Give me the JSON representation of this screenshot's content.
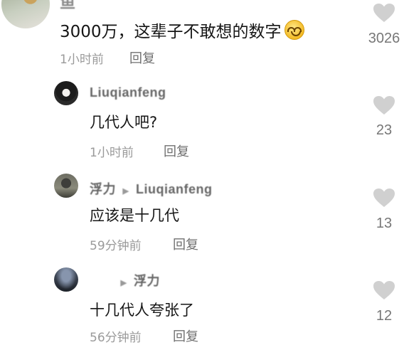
{
  "comments": [
    {
      "username": "鱼",
      "text": "3000万，这辈子不敢想的数字",
      "emoji": "smiling-emoji",
      "time": "1小时前",
      "reply_label": "回复",
      "likes": "3026"
    },
    {
      "username": "Liuqianfeng",
      "text": "几代人吧?",
      "time": "1小时前",
      "reply_label": "回复",
      "likes": "23"
    },
    {
      "username": "浮力",
      "reply_to": "Liuqianfeng",
      "text": "应该是十几代",
      "time": "59分钟前",
      "reply_label": "回复",
      "likes": "13"
    },
    {
      "username": "",
      "reply_to": "浮力",
      "text": "十几代人夸张了",
      "time": "56分钟前",
      "reply_label": "回复",
      "likes": "12"
    }
  ],
  "colors": {
    "heart": "#d0d0d0",
    "meta_text": "#9a9a9a",
    "body_text": "#161616"
  },
  "icons": {
    "like": "heart-icon",
    "reply_arrow": "triangle-right-icon"
  }
}
